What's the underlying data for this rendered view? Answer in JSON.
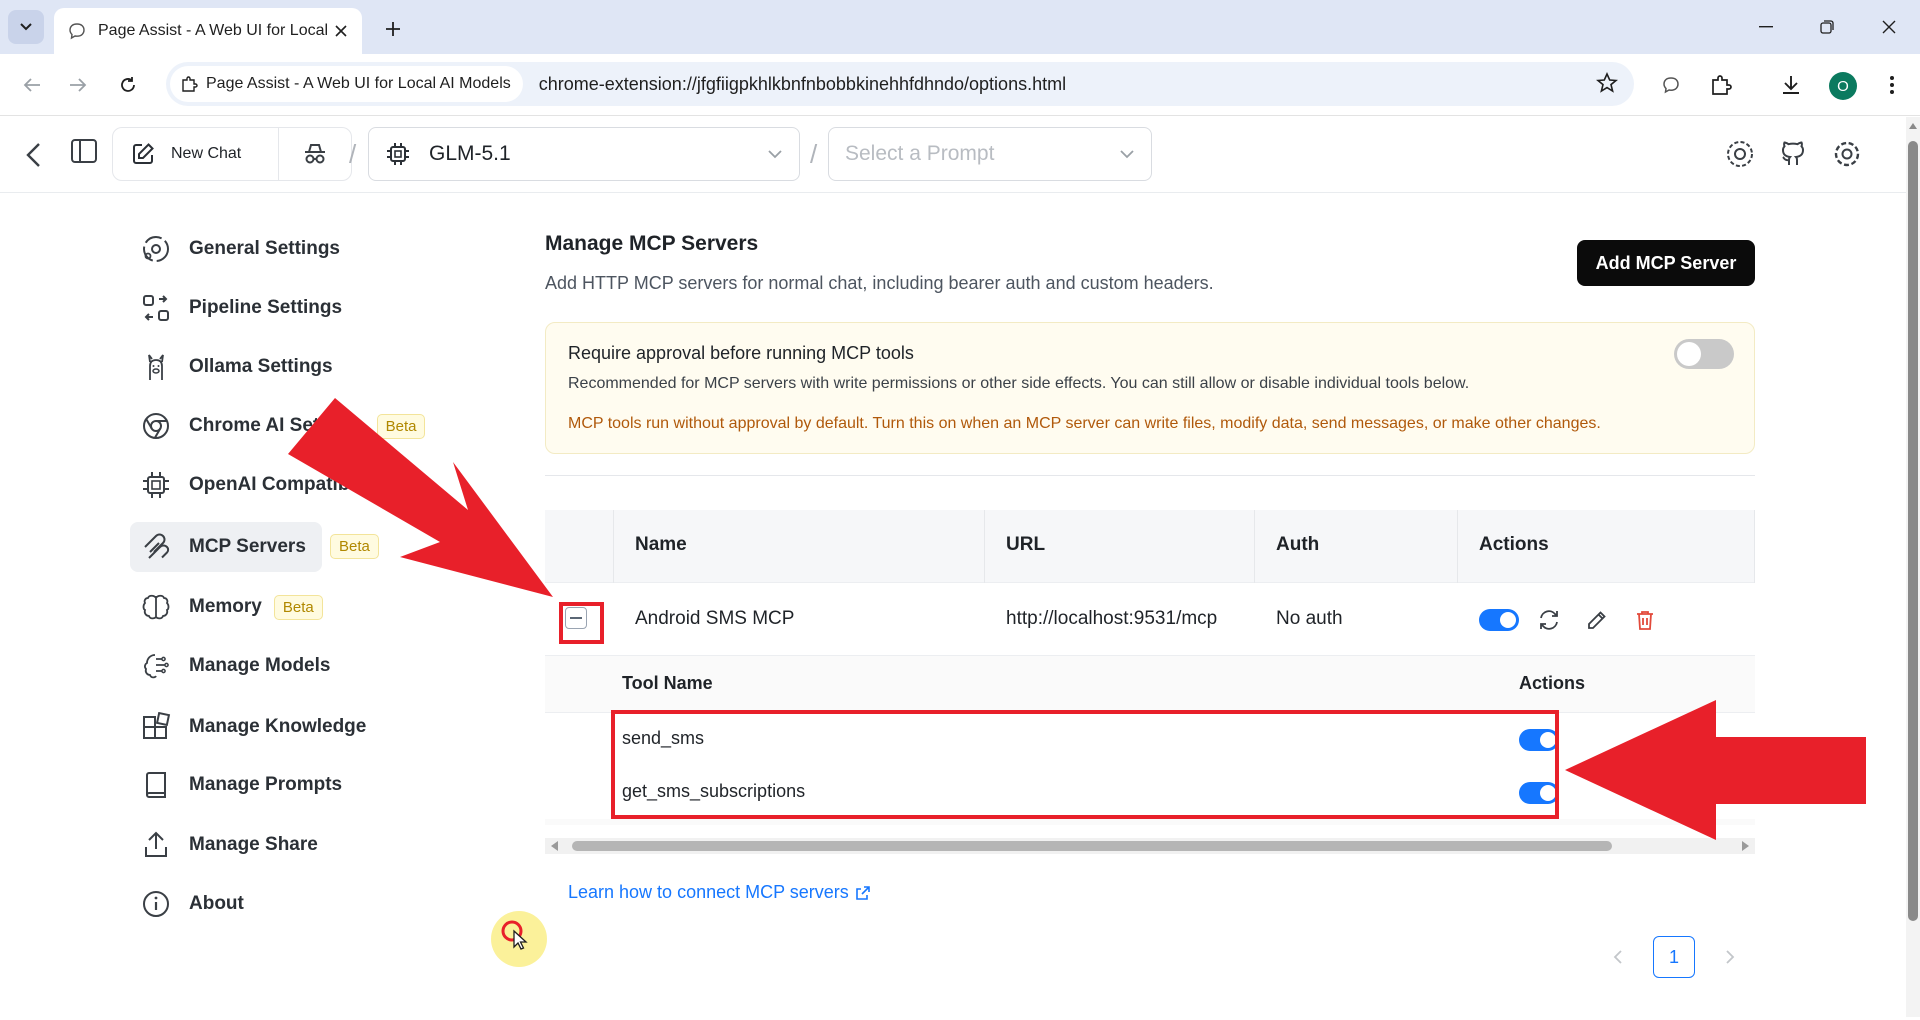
{
  "browser": {
    "tab_title": "Page Assist - A Web UI for Local AI Models",
    "site_chip": "Page Assist - A Web UI for Local AI Models",
    "url": "chrome-extension://jfgfiigpkhlkbnfnbobbkinehhfdhndo/options.html",
    "profile_initial": "O"
  },
  "header": {
    "new_chat": "New Chat",
    "separator": "/",
    "model": "GLM-5.1",
    "prompt_placeholder": "Select a Prompt"
  },
  "nav": {
    "beta_label": "Beta",
    "items": [
      {
        "label": "General Settings",
        "icon": "general-settings-icon"
      },
      {
        "label": "Pipeline Settings",
        "icon": "pipeline-icon"
      },
      {
        "label": "Ollama Settings",
        "icon": "ollama-icon"
      },
      {
        "label": "Chrome AI Settings",
        "icon": "chrome-icon",
        "beta": true
      },
      {
        "label": "OpenAI Compatible API",
        "icon": "chip-icon"
      },
      {
        "label": "MCP Servers",
        "icon": "mcp-icon",
        "beta": true,
        "active": true
      },
      {
        "label": "Memory",
        "icon": "brain-icon",
        "beta": true
      },
      {
        "label": "Manage Models",
        "icon": "models-icon"
      },
      {
        "label": "Manage Knowledge",
        "icon": "knowledge-icon"
      },
      {
        "label": "Manage Prompts",
        "icon": "book-icon"
      },
      {
        "label": "Manage Share",
        "icon": "share-icon"
      },
      {
        "label": "About",
        "icon": "info-icon"
      }
    ]
  },
  "main": {
    "title": "Manage MCP Servers",
    "subtitle": "Add HTTP MCP servers for normal chat, including bearer auth and custom headers.",
    "add_button": "Add MCP Server",
    "approval": {
      "title": "Require approval before running MCP tools",
      "description": "Recommended for MCP servers with write permissions or other side effects. You can still allow or disable individual tools below.",
      "warning": "MCP tools run without approval by default. Turn this on when an MCP server can write files, modify data, send messages, or make other changes.",
      "enabled": false
    },
    "table": {
      "columns": [
        "Name",
        "URL",
        "Auth",
        "Actions"
      ],
      "rows": [
        {
          "name": "Android SMS MCP",
          "url": "http://localhost:9531/mcp",
          "auth": "No auth",
          "enabled": true
        }
      ],
      "tools_columns": [
        "Tool Name",
        "Actions"
      ],
      "tools": [
        {
          "name": "send_sms",
          "enabled": true
        },
        {
          "name": "get_sms_subscriptions",
          "enabled": true
        }
      ]
    },
    "learn_link": "Learn how to connect MCP servers",
    "pagination": {
      "current": "1"
    }
  },
  "colors": {
    "accent": "#1677ff",
    "annotation": "#e8202a",
    "warning_text": "#b0590b",
    "delete": "#e24a3b"
  }
}
